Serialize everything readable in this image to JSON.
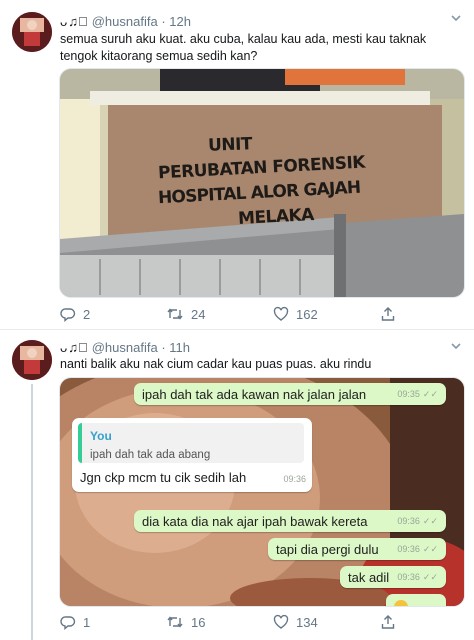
{
  "colors": {
    "accent": "#1da1f2",
    "muted": "#657786",
    "whatsapp_out": "#dcf8c6",
    "quote_bar": "#35cd96"
  },
  "tweets": [
    {
      "handle_glyphs": "ᴗ♫⃝",
      "handle": "@husnafifa",
      "sep": "·",
      "time": "12h",
      "text": "semua suruh aku kuat. aku cuba, kalau kau ada, mesti kau taknak tengok kitaorang semua sedih kan?",
      "sign_lines": [
        "UNIT",
        "PERUBATAN FORENSIK",
        "HOSPITAL ALOR GAJAH",
        "MELAKA"
      ],
      "replies": "2",
      "retweets": "24",
      "likes": "162"
    },
    {
      "handle_glyphs": "ᴗ♫⃝",
      "handle": "@husnafifa",
      "sep": "·",
      "time": "11h",
      "text": "nanti balik aku nak cium cadar kau puas puas. aku rindu",
      "replies": "1",
      "retweets": "16",
      "likes": "134",
      "chat": {
        "m1": {
          "text": "ipah dah tak ada kawan nak jalan jalan",
          "time": "09:35"
        },
        "quote_name": "You",
        "quote_text": "ipah dah tak ada abang",
        "m2": {
          "text": "Jgn ckp mcm tu cik sedih lah",
          "time": "09:36"
        },
        "m3": {
          "text": "dia kata dia nak ajar ipah bawak kereta",
          "time": "09:36"
        },
        "m4": {
          "text": "tapi dia pergi dulu",
          "time": "09:36"
        },
        "m5": {
          "text": "tak adil",
          "time": "09:36"
        }
      }
    }
  ]
}
